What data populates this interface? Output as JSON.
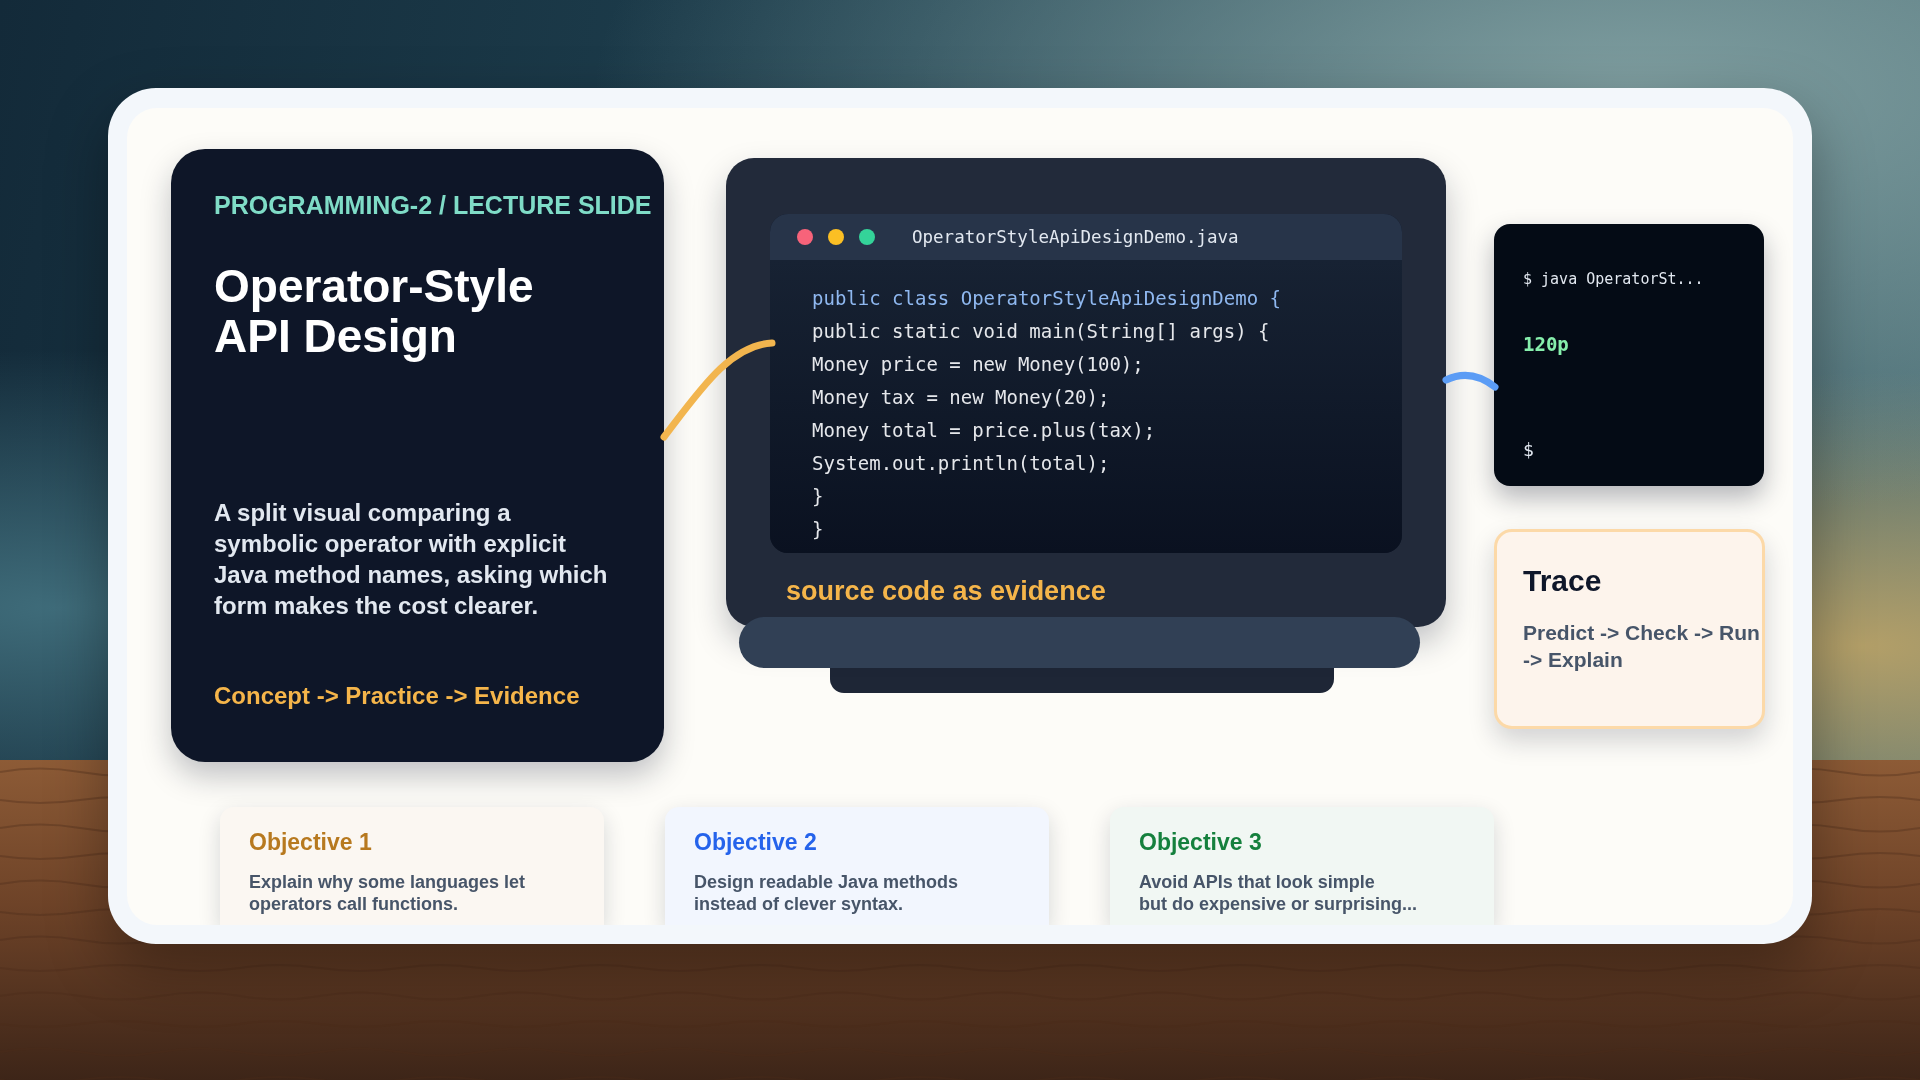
{
  "intro_card": {
    "eyebrow": "PROGRAMMING-2 / LECTURE SLIDE",
    "title": "Operator-Style API Design",
    "description": "A split visual comparing a symbolic operator with explicit Java method names, asking which form makes the cost clearer.",
    "flow": "Concept -> Practice -> Evidence"
  },
  "code_window": {
    "filename": "OperatorStyleApiDesignDemo.java",
    "lines": [
      {
        "text": "public class OperatorStyleApiDesignDemo {",
        "kind": "signature"
      },
      {
        "text": "public static void main(String[] args) {",
        "kind": "code"
      },
      {
        "text": "Money price = new Money(100);",
        "kind": "code"
      },
      {
        "text": "Money tax = new Money(20);",
        "kind": "code"
      },
      {
        "text": "Money total = price.plus(tax);",
        "kind": "code"
      },
      {
        "text": "System.out.println(total);",
        "kind": "code"
      },
      {
        "text": "}",
        "kind": "code"
      },
      {
        "text": "}",
        "kind": "code"
      }
    ],
    "caption": "source code as evidence"
  },
  "terminal": {
    "lines": [
      {
        "text": "$ java OperatorSt...",
        "kind": "command"
      },
      {
        "text": "120p",
        "kind": "output"
      },
      {
        "text": "$",
        "kind": "prompt"
      }
    ]
  },
  "trace_card": {
    "title": "Trace",
    "steps": "Predict -> Check -> Run -> Explain"
  },
  "objectives": [
    {
      "title": "Objective 1",
      "text": "Explain why some languages let\noperators call functions.",
      "color": "#b7791f"
    },
    {
      "title": "Objective 2",
      "text": "Design readable Java methods\ninstead of clever syntax.",
      "color": "#2563eb"
    },
    {
      "title": "Objective 3",
      "text": "Avoid APIs that look simple\nbut do expensive or surprising...",
      "color": "#15803d"
    }
  ]
}
